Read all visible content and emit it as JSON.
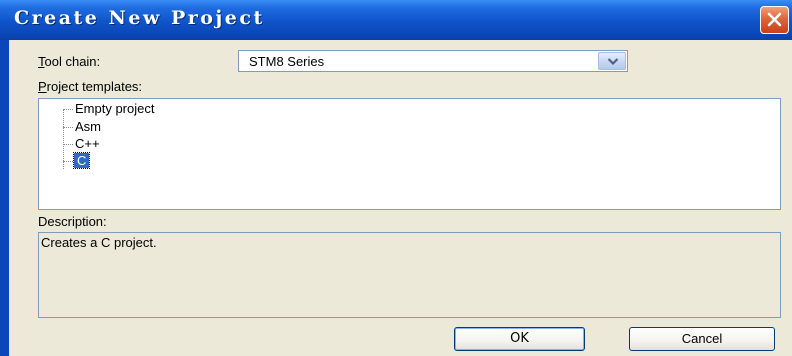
{
  "window": {
    "title": "Create New Project"
  },
  "toolchain": {
    "label": "Tool chain:",
    "selected": "STM8 Series"
  },
  "templates": {
    "label": "Project templates:",
    "items": [
      {
        "label": "Empty project",
        "selected": false
      },
      {
        "label": "Asm",
        "selected": false
      },
      {
        "label": "C++",
        "selected": false
      },
      {
        "label": "C",
        "selected": true
      }
    ]
  },
  "description": {
    "label": "Description:",
    "text": "Creates a C project."
  },
  "buttons": {
    "ok": "OK",
    "cancel": "Cancel"
  },
  "colors": {
    "title_bar": "#0B47B8",
    "selection": "#316AC5",
    "close": "#E0633A",
    "dialog_bg": "#ECE9D8"
  },
  "icons": {
    "close": "close-x-icon",
    "dropdown": "chevron-down-icon"
  }
}
